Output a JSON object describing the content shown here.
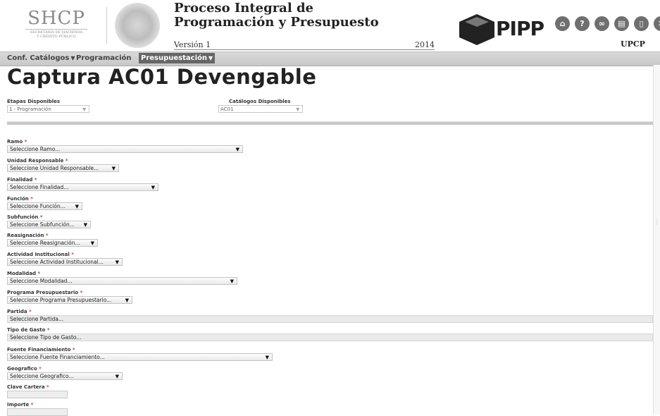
{
  "header": {
    "org_abbr": "SHCP",
    "org_line1": "SECRETARÍA DE HACIENDA",
    "org_line2": "Y CRÉDITO PÚBLICO",
    "app_title": "Proceso Integral de Programación y Presupuesto",
    "version": "Versión 1",
    "year": "2014",
    "brand": "PIPP",
    "unit": "UPCP",
    "icons": [
      "home-icon",
      "help-icon",
      "link-icon",
      "calendar-icon",
      "document-icon",
      "close-icon"
    ]
  },
  "menu": [
    {
      "label": "Conf. Catálogos",
      "active": false
    },
    {
      "label": "Programación",
      "active": false
    },
    {
      "label": "Presupuestación",
      "active": true
    }
  ],
  "page": {
    "title": "Captura AC01 Devengable",
    "etapas_label": "Etapas Disponibles",
    "etapas_value": "1 - Programación",
    "catalogos_label": "Catálogos Disponibles",
    "catalogos_value": "AC01"
  },
  "fields": [
    {
      "label": "Ramo",
      "value": "Seleccione Ramo..."
    },
    {
      "label": "Unidad Responsable",
      "value": "Seleccione Unidad Responsable..."
    },
    {
      "label": "Finalidad",
      "value": "Seleccione Finalidad..."
    },
    {
      "label": "Función",
      "value": "Seleccione Función..."
    },
    {
      "label": "Subfunción",
      "value": "Seleccione Subfunción..."
    },
    {
      "label": "Reasignación",
      "value": "Seleccione Reasignación..."
    },
    {
      "label": "Actividad Institucional",
      "value": "Seleccione Actividad Institucional..."
    },
    {
      "label": "Modalidad",
      "value": "Seleccione Modalidad..."
    },
    {
      "label": "Programa Presupuestario",
      "value": "Seleccione Programa Presupuestario..."
    },
    {
      "label": "Partida",
      "value": "Seleccione Partida..."
    },
    {
      "label": "Tipo de Gasto",
      "value": "Seleccione Tipo de Gasto..."
    },
    {
      "label": "Fuente Financiamiento",
      "value": "Seleccione Fuente Financiamiento..."
    },
    {
      "label": "Geografico",
      "value": "Seleccione Geografico..."
    },
    {
      "label": "Clave Cartera",
      "value": ""
    },
    {
      "label": "Importe",
      "value": ""
    }
  ],
  "required_mark": "*",
  "colors": {
    "menu_active": "#666666",
    "required": "#dd3333"
  }
}
